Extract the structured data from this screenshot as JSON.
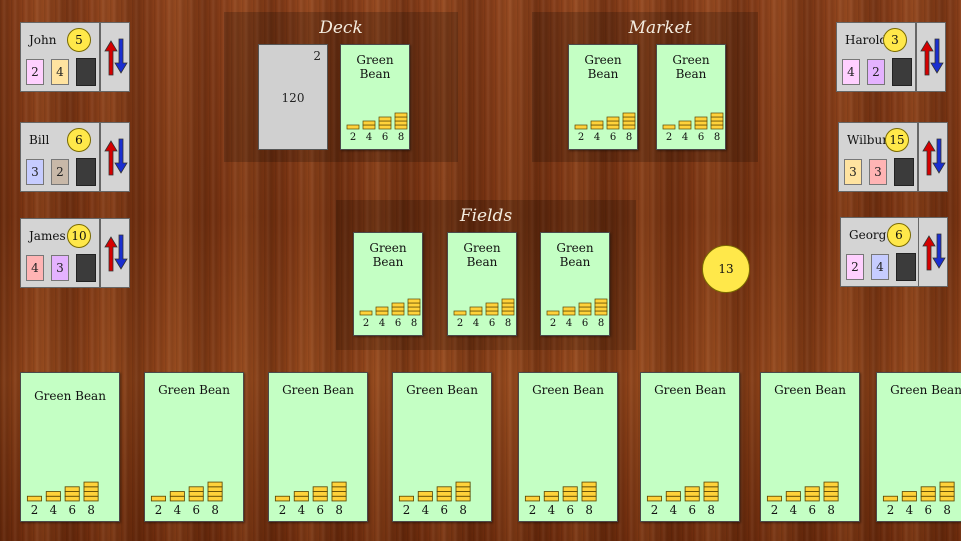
{
  "zones": {
    "deck_title": "Deck",
    "market_title": "Market",
    "fields_title": "Fields"
  },
  "deck": {
    "count": "120",
    "corner": "2"
  },
  "card_name": "Green Bean",
  "ladder_labels": [
    "2",
    "4",
    "6",
    "8"
  ],
  "colors": {
    "card": "#c4ffc4",
    "coin": "#ffe84a",
    "arrow_up": "#d40000",
    "arrow_down": "#1a2fd0"
  },
  "pot": "13",
  "players": [
    {
      "name": "John",
      "coins": "5",
      "cards": [
        {
          "v": "2",
          "c": "#ffd0ff"
        },
        {
          "v": "4",
          "c": "#ffe3a0"
        }
      ]
    },
    {
      "name": "Bill",
      "coins": "6",
      "cards": [
        {
          "v": "3",
          "c": "#c6ccff"
        },
        {
          "v": "2",
          "c": "#c8b8a8"
        }
      ]
    },
    {
      "name": "James",
      "coins": "10",
      "cards": [
        {
          "v": "4",
          "c": "#ffb4b4"
        },
        {
          "v": "3",
          "c": "#e4b2ff"
        }
      ]
    },
    {
      "name": "Harold",
      "coins": "3",
      "cards": [
        {
          "v": "4",
          "c": "#ffd0ff"
        },
        {
          "v": "2",
          "c": "#e4b2ff"
        }
      ]
    },
    {
      "name": "Wilbur",
      "coins": "15",
      "cards": [
        {
          "v": "3",
          "c": "#ffe3a0"
        },
        {
          "v": "3",
          "c": "#ffb4b4"
        }
      ]
    },
    {
      "name": "George",
      "coins": "6",
      "cards": [
        {
          "v": "2",
          "c": "#ffd0ff"
        },
        {
          "v": "4",
          "c": "#c6ccff"
        }
      ]
    }
  ]
}
